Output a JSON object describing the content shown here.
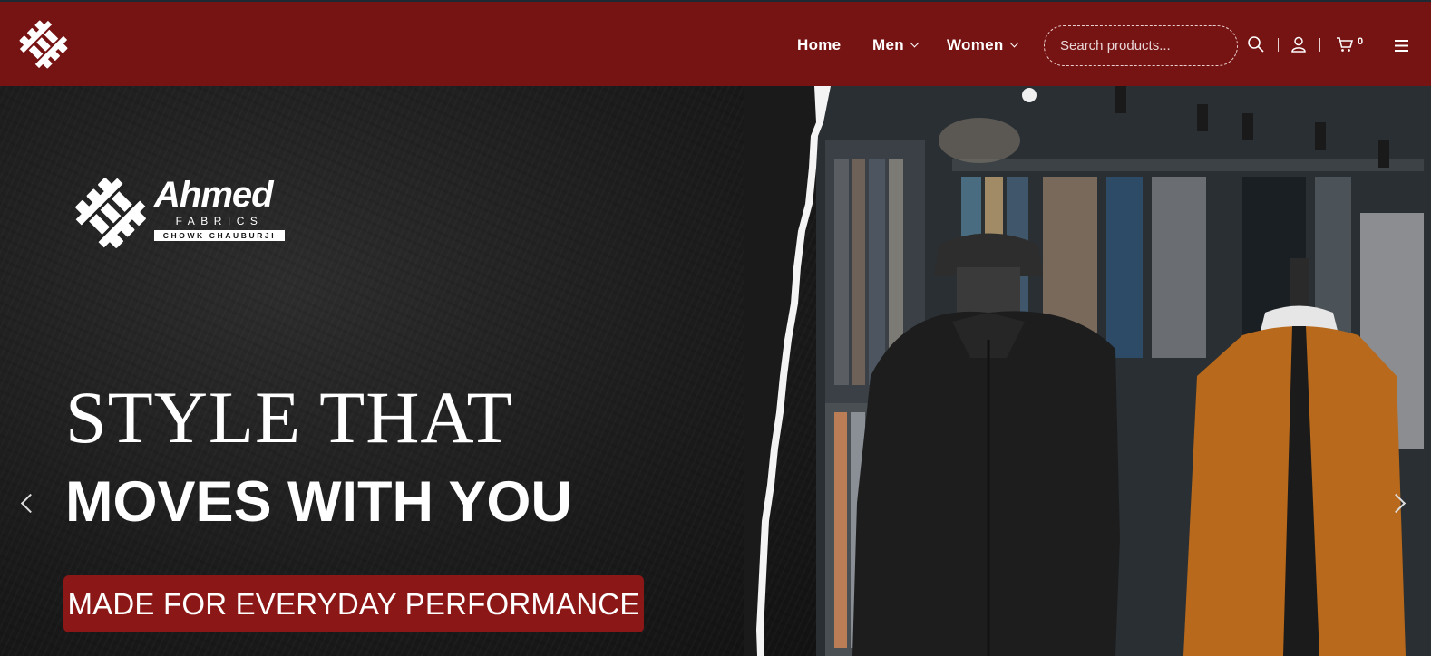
{
  "header": {
    "logo_icon": "brand-knot-icon",
    "nav": [
      {
        "label": "Home",
        "has_dropdown": false
      },
      {
        "label": "Men",
        "has_dropdown": true
      },
      {
        "label": "Women",
        "has_dropdown": true
      }
    ],
    "search": {
      "placeholder": "Search products...",
      "value": ""
    },
    "icons": [
      "search-icon",
      "user-icon",
      "cart-icon",
      "menu-icon"
    ],
    "cart_count": "0"
  },
  "hero": {
    "brand": {
      "name": "Ahmed",
      "sub": "FABRICS",
      "tagline": "CHOWK CHAUBURJI"
    },
    "headline_1": "STYLE THAT",
    "headline_2": "MOVES WITH YOU",
    "badge": "MADE FOR EVERYDAY PERFORMANCE"
  },
  "colors": {
    "brand_red": "#761313",
    "badge_red": "#8b1717",
    "orange_jacket": "#b8691b"
  }
}
